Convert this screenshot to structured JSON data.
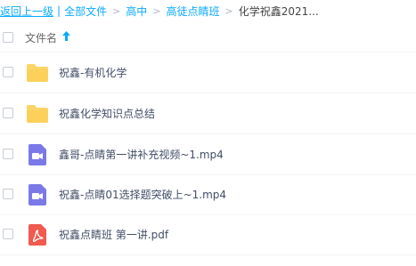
{
  "breadcrumb": {
    "back": "返回上一级",
    "separator_bar": "|",
    "items": [
      "全部文件",
      "高中",
      "高徒点睛班",
      "化学祝鑫2021..."
    ],
    "separator": ">"
  },
  "header": {
    "column_label": "文件名",
    "sort_icon": "arrow-up-icon"
  },
  "files": [
    {
      "name": "祝鑫-有机化学",
      "type": "folder"
    },
    {
      "name": "祝鑫化学知识点总结",
      "type": "folder"
    },
    {
      "name": "鑫哥-点睛第一讲补充视频~1.mp4",
      "type": "video"
    },
    {
      "name": "祝鑫-点睛01选择题突破上~1.mp4",
      "type": "video"
    },
    {
      "name": "祝鑫点睛班 第一讲.pdf",
      "type": "pdf"
    }
  ],
  "colors": {
    "accent": "#09aaff",
    "folder": "#fdd466",
    "video": "#7b79e8",
    "pdf": "#f05a4f"
  }
}
